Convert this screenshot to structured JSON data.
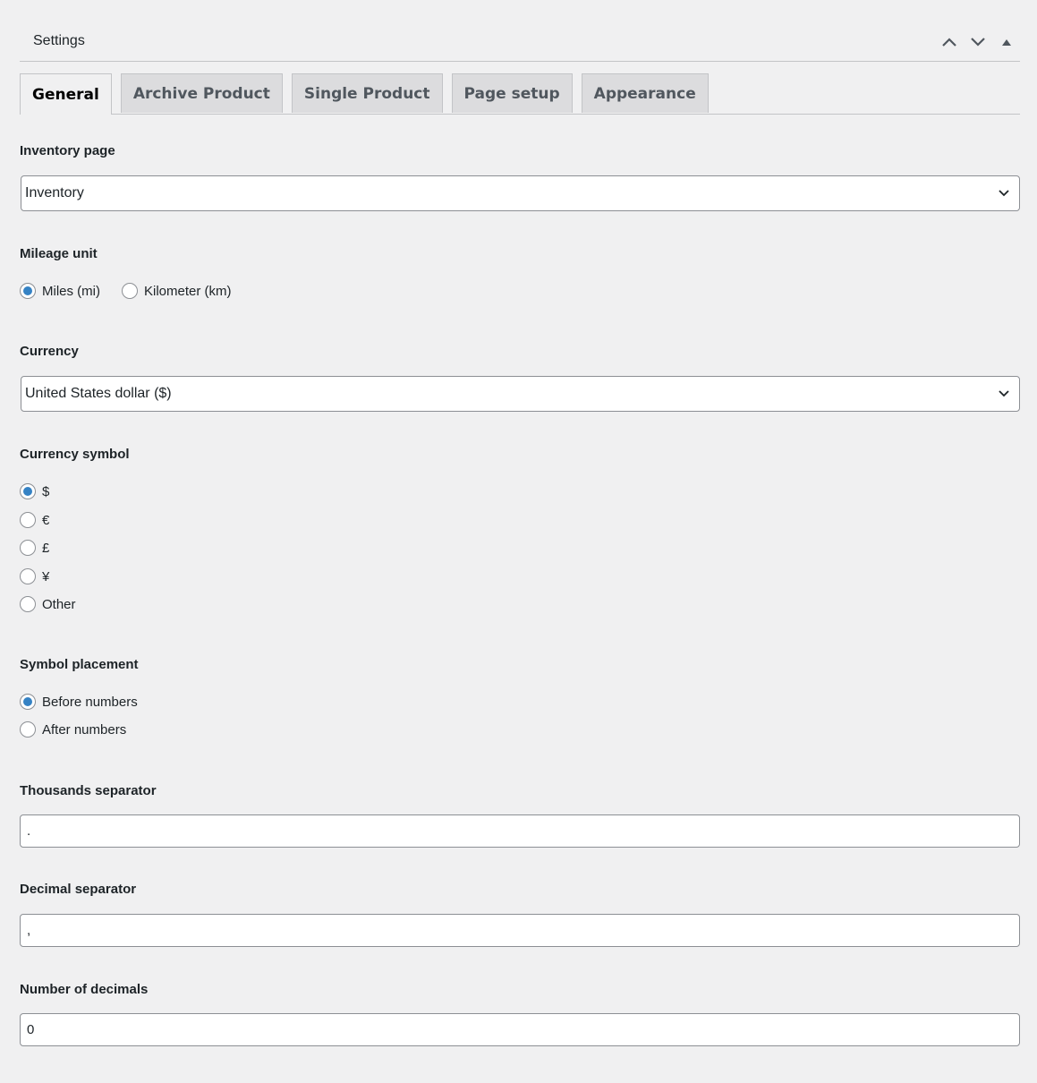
{
  "panel": {
    "title": "Settings"
  },
  "tabs": [
    {
      "label": "General",
      "active": true
    },
    {
      "label": "Archive Product",
      "active": false
    },
    {
      "label": "Single Product",
      "active": false
    },
    {
      "label": "Page setup",
      "active": false
    },
    {
      "label": "Appearance",
      "active": false
    }
  ],
  "fields": {
    "inventory_page": {
      "label": "Inventory page",
      "value": "Inventory"
    },
    "mileage_unit": {
      "label": "Mileage unit",
      "options": [
        {
          "label": "Miles (mi)",
          "checked": true
        },
        {
          "label": "Kilometer (km)",
          "checked": false
        }
      ]
    },
    "currency": {
      "label": "Currency",
      "value": "United States dollar ($)"
    },
    "currency_symbol": {
      "label": "Currency symbol",
      "options": [
        {
          "label": "$",
          "checked": true
        },
        {
          "label": "€",
          "checked": false
        },
        {
          "label": "£",
          "checked": false
        },
        {
          "label": "¥",
          "checked": false
        },
        {
          "label": "Other",
          "checked": false
        }
      ]
    },
    "symbol_placement": {
      "label": "Symbol placement",
      "options": [
        {
          "label": "Before numbers",
          "checked": true
        },
        {
          "label": "After numbers",
          "checked": false
        }
      ]
    },
    "thousands_separator": {
      "label": "Thousands separator",
      "value": "."
    },
    "decimal_separator": {
      "label": "Decimal separator",
      "value": ","
    },
    "number_of_decimals": {
      "label": "Number of decimals",
      "value": "0"
    }
  },
  "colors": {
    "background": "#f0f0f1",
    "radio_accent": "#3582c4",
    "border": "#8c8f94"
  }
}
